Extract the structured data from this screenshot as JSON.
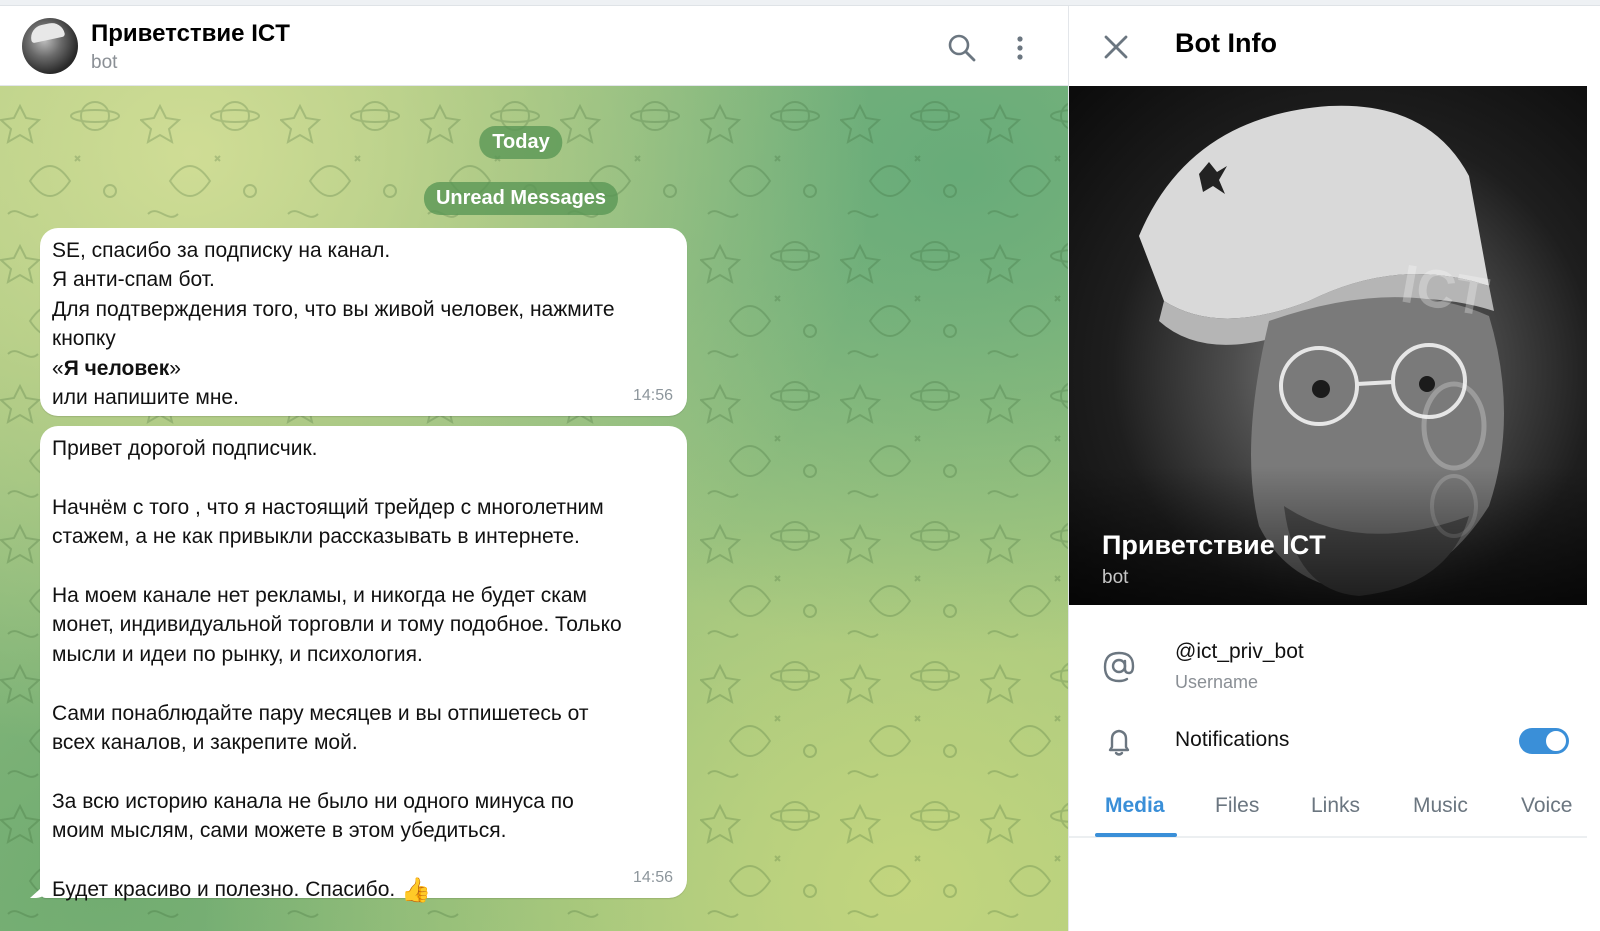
{
  "chat": {
    "title": "Приветствие ICT",
    "subtitle": "bot",
    "date_pill": "Today",
    "unread_pill": "Unread Messages",
    "messages": [
      {
        "lines": [
          "SE, спасибо за подписку на канал.",
          "Я анти-спам бот.",
          "Для подтверждения того, что вы живой человек, нажмите",
          "кнопку",
          "«",
          "Я человек",
          "»",
          "или напишите мне."
        ],
        "time": "14:56"
      },
      {
        "lines": [
          "Привет дорогой подписчик.",
          "",
          "Начнём с того , что я настоящий трейдер с многолетним",
          "стажем, а не как привыкли рассказывать в интернете.",
          "",
          "На моем канале нет рекламы, и никогда не будет скам",
          "монет, индивидуальной торговли и тому подобное. Только",
          "мысли и идеи по рынку, и психология.",
          "",
          "Сами понаблюдайте пару месяцев и вы отпишетесь от",
          "всех каналов, и закрепите мой.",
          "",
          "За всю историю канала не было ни одного минуса по",
          "моим мыслям, сами можете в этом убедиться.",
          "",
          "Будет красиво и полезно. Спасибо."
        ],
        "emoji": "👍",
        "time": "14:56"
      }
    ]
  },
  "info": {
    "title": "Bot Info",
    "photo_name": "Приветствие ICT",
    "photo_sub": "bot",
    "username": "@ict_priv_bot",
    "username_label": "Username",
    "notifications_label": "Notifications",
    "notifications_on": true,
    "tabs": [
      "Media",
      "Files",
      "Links",
      "Music",
      "Voice"
    ],
    "active_tab": "Media"
  },
  "colors": {
    "accent": "#3a8fd8",
    "pill": "#589654",
    "bubble": "#ffffff"
  },
  "icons": [
    "search-icon",
    "more-vertical-icon",
    "close-icon",
    "at-sign-icon",
    "bell-icon"
  ]
}
